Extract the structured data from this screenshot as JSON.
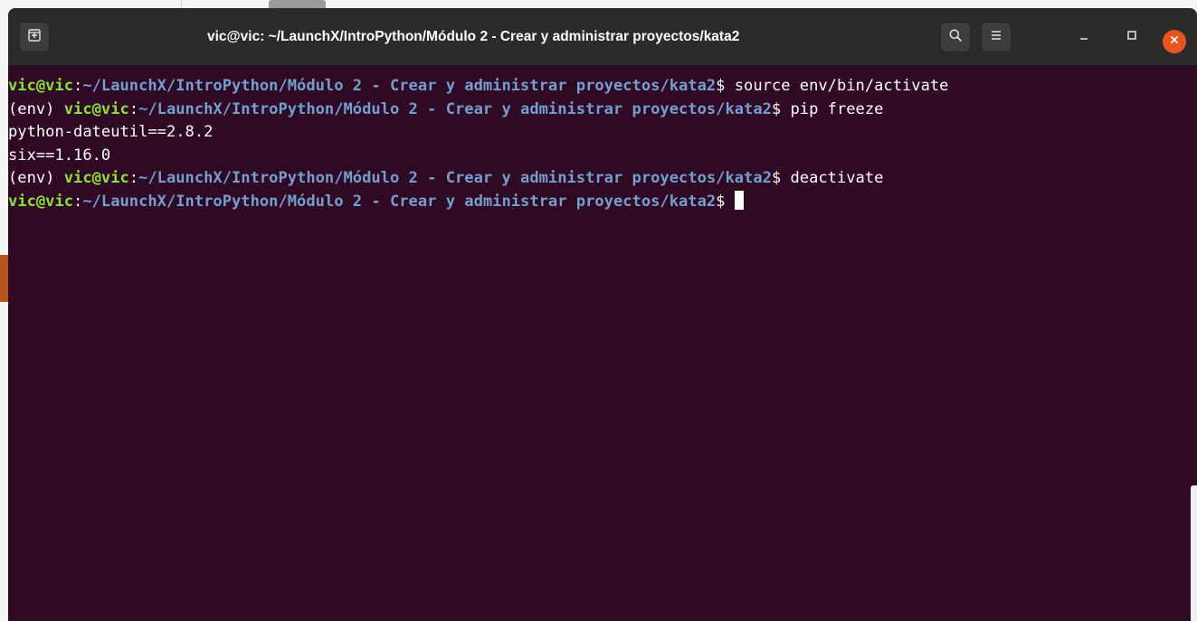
{
  "window": {
    "title": "vic@vic: ~/LaunchX/IntroPython/Módulo 2 - Crear y administrar proyectos/kata2"
  },
  "icons": {
    "new_tab": "new-tab-icon",
    "search": "search-icon",
    "menu": "hamburger-menu-icon",
    "minimize": "minimize-icon",
    "maximize": "maximize-icon",
    "close": "close-icon"
  },
  "colors": {
    "terminal_bg": "#300a24",
    "titlebar_bg": "#2b2b2b",
    "prompt_user": "#8ae234",
    "prompt_path": "#729fcf",
    "close_button": "#e95420"
  },
  "terminal": {
    "lines": [
      {
        "venv": "",
        "user": "vic@vic",
        "sep": ":",
        "path": "~/LaunchX/IntroPython/Módulo 2 - Crear y administrar proyectos/kata2",
        "command": "$ source env/bin/activate"
      },
      {
        "venv": "(env) ",
        "user": "vic@vic",
        "sep": ":",
        "path": "~/LaunchX/IntroPython/Módulo 2 - Crear y administrar proyectos/kata2",
        "command": "$ pip freeze"
      },
      {
        "output": "python-dateutil==2.8.2"
      },
      {
        "output": "six==1.16.0"
      },
      {
        "venv": "(env) ",
        "user": "vic@vic",
        "sep": ":",
        "path": "~/LaunchX/IntroPython/Módulo 2 - Crear y administrar proyectos/kata2",
        "command": "$ deactivate"
      },
      {
        "venv": "",
        "user": "vic@vic",
        "sep": ":",
        "path": "~/LaunchX/IntroPython/Módulo 2 - Crear y administrar proyectos/kata2",
        "command": "$ "
      }
    ]
  }
}
